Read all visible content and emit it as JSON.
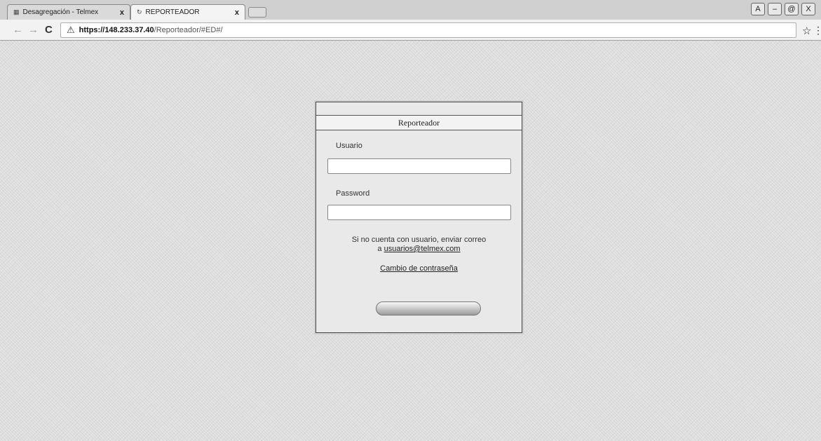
{
  "browser": {
    "tabs": [
      {
        "label": "Desagregación - Telmex",
        "close": "x",
        "active": false
      },
      {
        "label": "REPORTEADOR",
        "close": "x",
        "active": true
      }
    ],
    "url": {
      "host": "https://148.233.37.40",
      "path": "/Reporteador/#ED#/"
    },
    "window_controls": [
      "A",
      "–",
      "@",
      "X"
    ]
  },
  "login": {
    "title": "Reporteador",
    "username_label": "Usuario",
    "username_value": "",
    "password_label": "Password",
    "password_value": "",
    "help_line1": "Si no cuenta con usuario, enviar correo",
    "help_line2_prefix": "a ",
    "help_email": "usuarios@telmex.com",
    "change_password_link": "Cambio de contraseña",
    "submit_label": ""
  },
  "colors": {
    "page_background": "#e4e4e4",
    "panel_background": "#e9e9e9",
    "panel_border": "#444444"
  }
}
